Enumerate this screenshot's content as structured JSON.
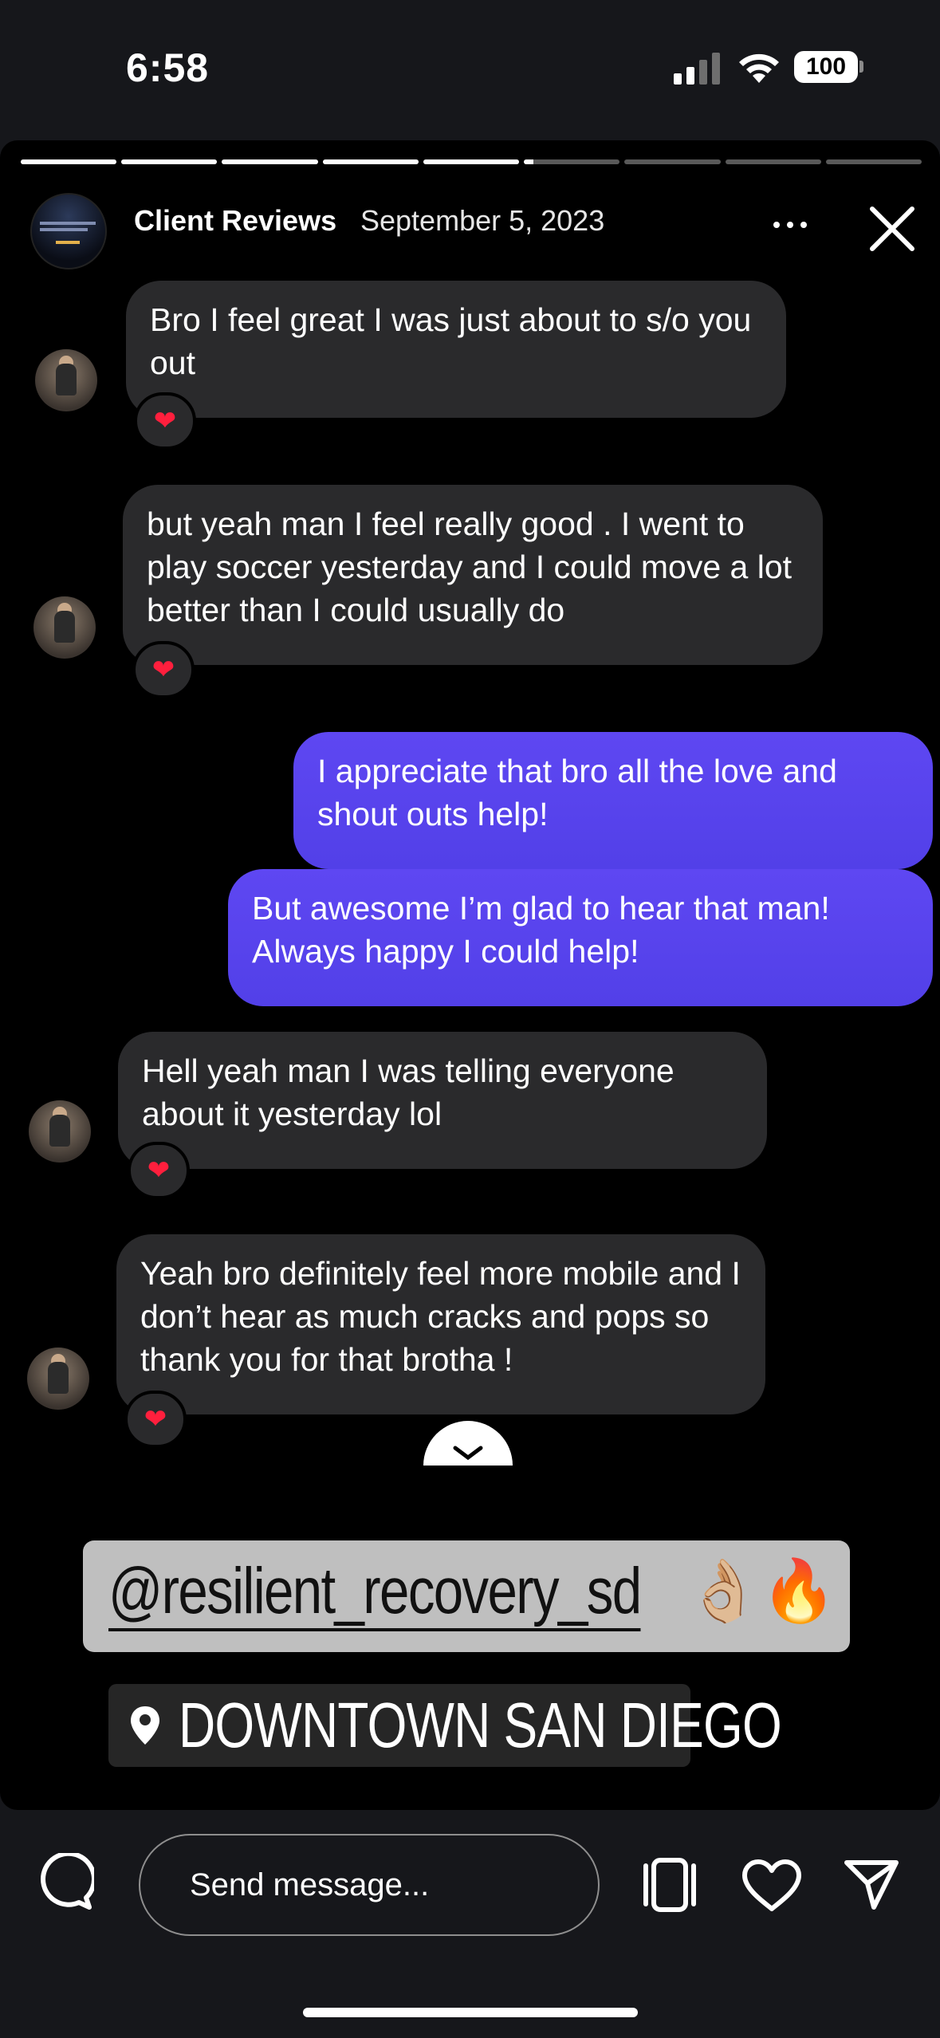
{
  "status_bar": {
    "time": "6:58",
    "battery": "100"
  },
  "story": {
    "segments_total": 9,
    "segments_complete": 5,
    "current_segment_fraction": 0.1,
    "profile_name": "Client Reviews",
    "date": "September 5, 2023"
  },
  "messages": [
    {
      "side": "incoming",
      "text": "Bro I feel great I was just about to s/o you out",
      "reaction": "heart"
    },
    {
      "side": "incoming",
      "text": "but yeah man I feel really good . I went to play soccer yesterday and I could move a lot better than I could usually do",
      "reaction": "heart"
    },
    {
      "side": "outgoing",
      "text": "I appreciate that bro all the love and shout outs help!"
    },
    {
      "side": "outgoing",
      "text": "But awesome I’m glad to hear that man! Always happy I could help!"
    },
    {
      "side": "incoming",
      "text": "Hell yeah man I was telling everyone about it yesterday lol",
      "reaction": "heart"
    },
    {
      "side": "incoming",
      "text": "Yeah bro definitely feel more mobile and I don’t hear as much cracks and pops so thank you for that brotha !",
      "reaction": "heart"
    }
  ],
  "stickers": {
    "mention": "@resilient_recovery_sd",
    "mention_emoji": "👌🏼🔥",
    "location": "DOWNTOWN SAN DIEGO"
  },
  "bottom_bar": {
    "message_placeholder": "Send message..."
  },
  "colors": {
    "outgoing_bubble": "#5b46f0",
    "incoming_bubble": "#2a2a2c",
    "reaction_heart": "#ff1f3d"
  }
}
